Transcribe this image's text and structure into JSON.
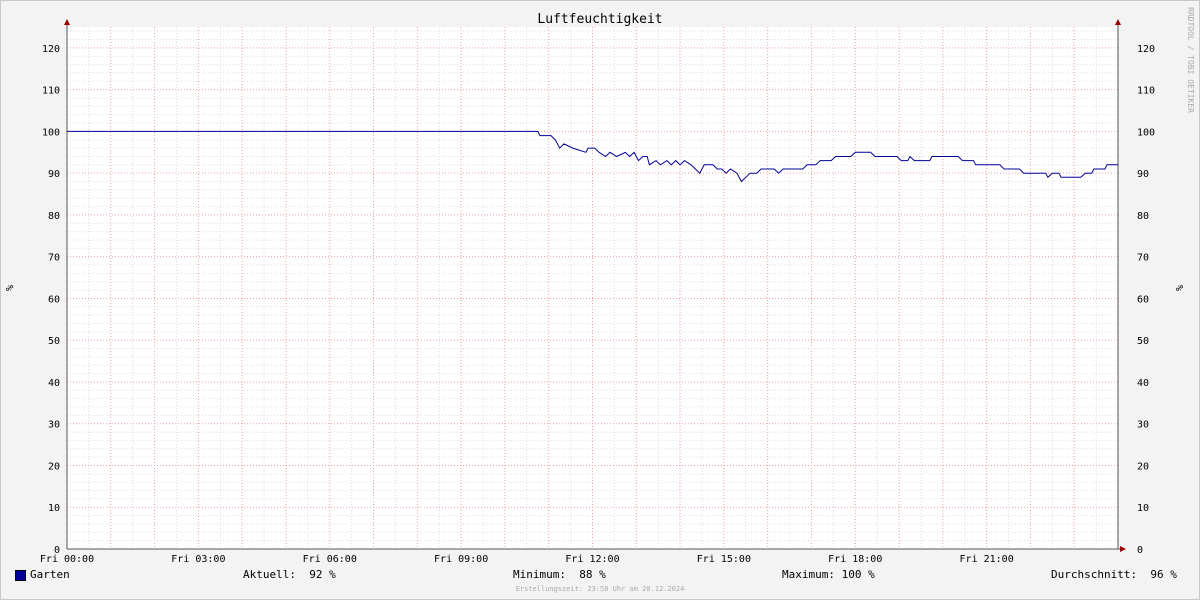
{
  "chart_data": {
    "type": "line",
    "title": "Luftfeuchtigkeit",
    "ylabel": "%",
    "ylim": [
      0,
      125
    ],
    "yticks": [
      0,
      10,
      20,
      30,
      40,
      50,
      60,
      70,
      80,
      90,
      100,
      110,
      120
    ],
    "xlim": [
      0,
      24
    ],
    "xticks": [
      {
        "x": 0,
        "label": "Fri 00:00"
      },
      {
        "x": 3,
        "label": "Fri 03:00"
      },
      {
        "x": 6,
        "label": "Fri 06:00"
      },
      {
        "x": 9,
        "label": "Fri 09:00"
      },
      {
        "x": 12,
        "label": "Fri 12:00"
      },
      {
        "x": 15,
        "label": "Fri 15:00"
      },
      {
        "x": 18,
        "label": "Fri 18:00"
      },
      {
        "x": 21,
        "label": "Fri 21:00"
      }
    ],
    "grid": true,
    "watermark": "RRDTOOL / TOBI OETIKER",
    "series": [
      {
        "name": "Garten",
        "color": "#000099",
        "points": [
          [
            0,
            100
          ],
          [
            10.75,
            100
          ],
          [
            10.8,
            99
          ],
          [
            11.05,
            99
          ],
          [
            11.15,
            98
          ],
          [
            11.25,
            96
          ],
          [
            11.35,
            97
          ],
          [
            11.55,
            96
          ],
          [
            11.85,
            95
          ],
          [
            11.9,
            96
          ],
          [
            12.05,
            96
          ],
          [
            12.15,
            95
          ],
          [
            12.3,
            94
          ],
          [
            12.4,
            95
          ],
          [
            12.55,
            94
          ],
          [
            12.75,
            95
          ],
          [
            12.85,
            94
          ],
          [
            12.95,
            95
          ],
          [
            13.05,
            93
          ],
          [
            13.15,
            94
          ],
          [
            13.25,
            94
          ],
          [
            13.3,
            92
          ],
          [
            13.45,
            93
          ],
          [
            13.55,
            92
          ],
          [
            13.7,
            93
          ],
          [
            13.8,
            92
          ],
          [
            13.9,
            93
          ],
          [
            14.0,
            92
          ],
          [
            14.1,
            93
          ],
          [
            14.25,
            92
          ],
          [
            14.35,
            91
          ],
          [
            14.45,
            90
          ],
          [
            14.55,
            92
          ],
          [
            14.75,
            92
          ],
          [
            14.85,
            91
          ],
          [
            14.95,
            91
          ],
          [
            15.05,
            90
          ],
          [
            15.15,
            91
          ],
          [
            15.3,
            90
          ],
          [
            15.4,
            88
          ],
          [
            15.5,
            89
          ],
          [
            15.6,
            90
          ],
          [
            15.75,
            90
          ],
          [
            15.85,
            91
          ],
          [
            16.15,
            91
          ],
          [
            16.25,
            90
          ],
          [
            16.35,
            91
          ],
          [
            16.8,
            91
          ],
          [
            16.9,
            92
          ],
          [
            17.1,
            92
          ],
          [
            17.2,
            93
          ],
          [
            17.45,
            93
          ],
          [
            17.55,
            94
          ],
          [
            17.9,
            94
          ],
          [
            18.0,
            95
          ],
          [
            18.35,
            95
          ],
          [
            18.45,
            94
          ],
          [
            18.95,
            94
          ],
          [
            19.05,
            93
          ],
          [
            19.2,
            93
          ],
          [
            19.25,
            94
          ],
          [
            19.35,
            93
          ],
          [
            19.7,
            93
          ],
          [
            19.75,
            94
          ],
          [
            20.35,
            94
          ],
          [
            20.45,
            93
          ],
          [
            20.7,
            93
          ],
          [
            20.75,
            92
          ],
          [
            21.3,
            92
          ],
          [
            21.4,
            91
          ],
          [
            21.75,
            91
          ],
          [
            21.85,
            90
          ],
          [
            22.35,
            90
          ],
          [
            22.4,
            89
          ],
          [
            22.5,
            90
          ],
          [
            22.65,
            90
          ],
          [
            22.7,
            89
          ],
          [
            23.15,
            89
          ],
          [
            23.25,
            90
          ],
          [
            23.4,
            90
          ],
          [
            23.45,
            91
          ],
          [
            23.7,
            91
          ],
          [
            23.75,
            92
          ],
          [
            24,
            92
          ]
        ]
      }
    ]
  },
  "legend": {
    "name": "Garten",
    "color": "#000099",
    "current": "Aktuell:  92 %",
    "minimum": "Minimum:  88 %",
    "maximum": "Maximum: 100 %",
    "average": "Durchschnitt:  96 %"
  },
  "footer": "Erstellungszeit: 23:58 Uhr am 20.12.2024"
}
